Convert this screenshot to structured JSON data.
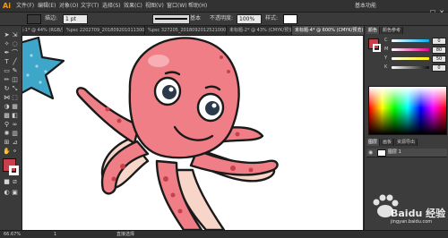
{
  "app": {
    "logo": "Ai"
  },
  "menu": {
    "items": [
      "文件(F)",
      "编辑(E)",
      "对象(O)",
      "文字(T)",
      "选择(S)",
      "效果(C)",
      "视图(V)",
      "窗口(W)",
      "帮助(H)"
    ],
    "workspace": "基本功能",
    "window_controls": [
      "—",
      "□",
      "✕"
    ]
  },
  "control": {
    "fill_color": "#c8404c",
    "stroke_label": "描边:",
    "stroke_value": "1 pt",
    "stroke_style": "基本",
    "opacity_label": "不透明度:",
    "opacity_value": "100%",
    "style_label": "样式:"
  },
  "tabs": [
    {
      "label": "未标题-1* @ 44% (RGB/预览)",
      "active": false
    },
    {
      "label": "%psc 2202709_20180920101130001B4.jpg*",
      "active": false
    },
    {
      "label": "%psc 327205_20180920125210001E.jpg*",
      "active": false
    },
    {
      "label": "未标题-2* @ 43% (CMYK/预览)",
      "active": false
    },
    {
      "label": "未标题-4* @ 600% (CMYK/预览)",
      "active": true
    }
  ],
  "right_panel": {
    "top_tabs": [
      "颜色",
      "颜色参考"
    ],
    "sliders": [
      {
        "letter": "C",
        "value": "0",
        "color": "#00aeef"
      },
      {
        "letter": "M",
        "value": "80",
        "color": "#ec008c"
      },
      {
        "letter": "Y",
        "value": "50",
        "color": "#fff200"
      },
      {
        "letter": "K",
        "value": "0",
        "color": "#111111"
      }
    ],
    "bottom_tabs": [
      "图层",
      "画板",
      "资源导出"
    ],
    "layer_name": "图层 1"
  },
  "colors": {
    "fill": "#c8404c",
    "stroke": "#ffffff",
    "octopus_body": "#ef7e87",
    "octopus_dark": "#c8404c",
    "octopus_light": "#f7d5c8",
    "starfish": "#3ea6c8"
  },
  "status": {
    "zoom": "66.67%",
    "page": "1",
    "tool": "直接选择"
  },
  "watermark": {
    "text": "Baidu 经验",
    "sub": "jingyan.baidu.com"
  }
}
